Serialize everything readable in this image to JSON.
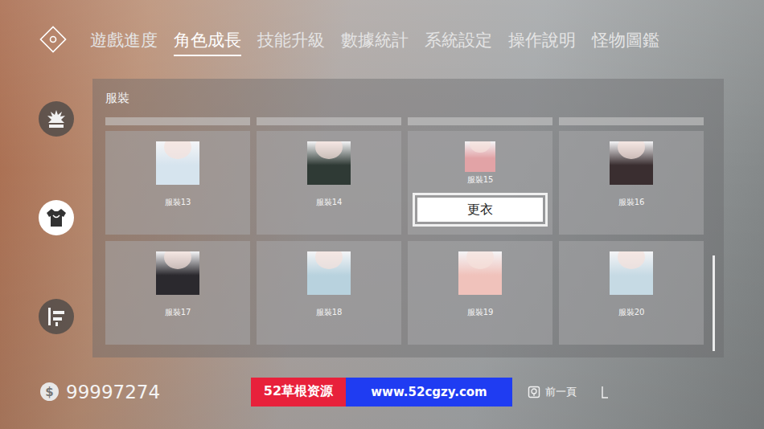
{
  "nav": {
    "tabs": [
      {
        "label": "遊戲進度",
        "selected": false
      },
      {
        "label": "角色成長",
        "selected": true
      },
      {
        "label": "技能升級",
        "selected": false
      },
      {
        "label": "數據統計",
        "selected": false
      },
      {
        "label": "系統設定",
        "selected": false
      },
      {
        "label": "操作說明",
        "selected": false
      },
      {
        "label": "怪物圖鑑",
        "selected": false
      }
    ]
  },
  "sidebar": {
    "items": [
      {
        "selected": false,
        "kind": "skill"
      },
      {
        "selected": true,
        "kind": "costume"
      },
      {
        "selected": false,
        "kind": "weapon"
      }
    ]
  },
  "panel": {
    "title": "服裝",
    "items": [
      {
        "label": "服裝13",
        "selected": false,
        "color": "#d6e4ee"
      },
      {
        "label": "服裝14",
        "selected": false,
        "color": "#2f3a35"
      },
      {
        "label": "服裝15",
        "selected": true,
        "color": "#e2a3a6"
      },
      {
        "label": "服裝16",
        "selected": false,
        "color": "#3a2e30"
      },
      {
        "label": "服裝17",
        "selected": false,
        "color": "#2b292e"
      },
      {
        "label": "服裝18",
        "selected": false,
        "color": "#b8d2de"
      },
      {
        "label": "服裝19",
        "selected": false,
        "color": "#f0c2bb"
      },
      {
        "label": "服裝20",
        "selected": false,
        "color": "#c6dae4"
      }
    ],
    "action": "更衣"
  },
  "money": {
    "symbol": "$",
    "amount": "99997274"
  },
  "watermark": {
    "brand": "52草根资源",
    "url": "www.52cgzy.com"
  },
  "footer": {
    "back": "前一頁"
  }
}
